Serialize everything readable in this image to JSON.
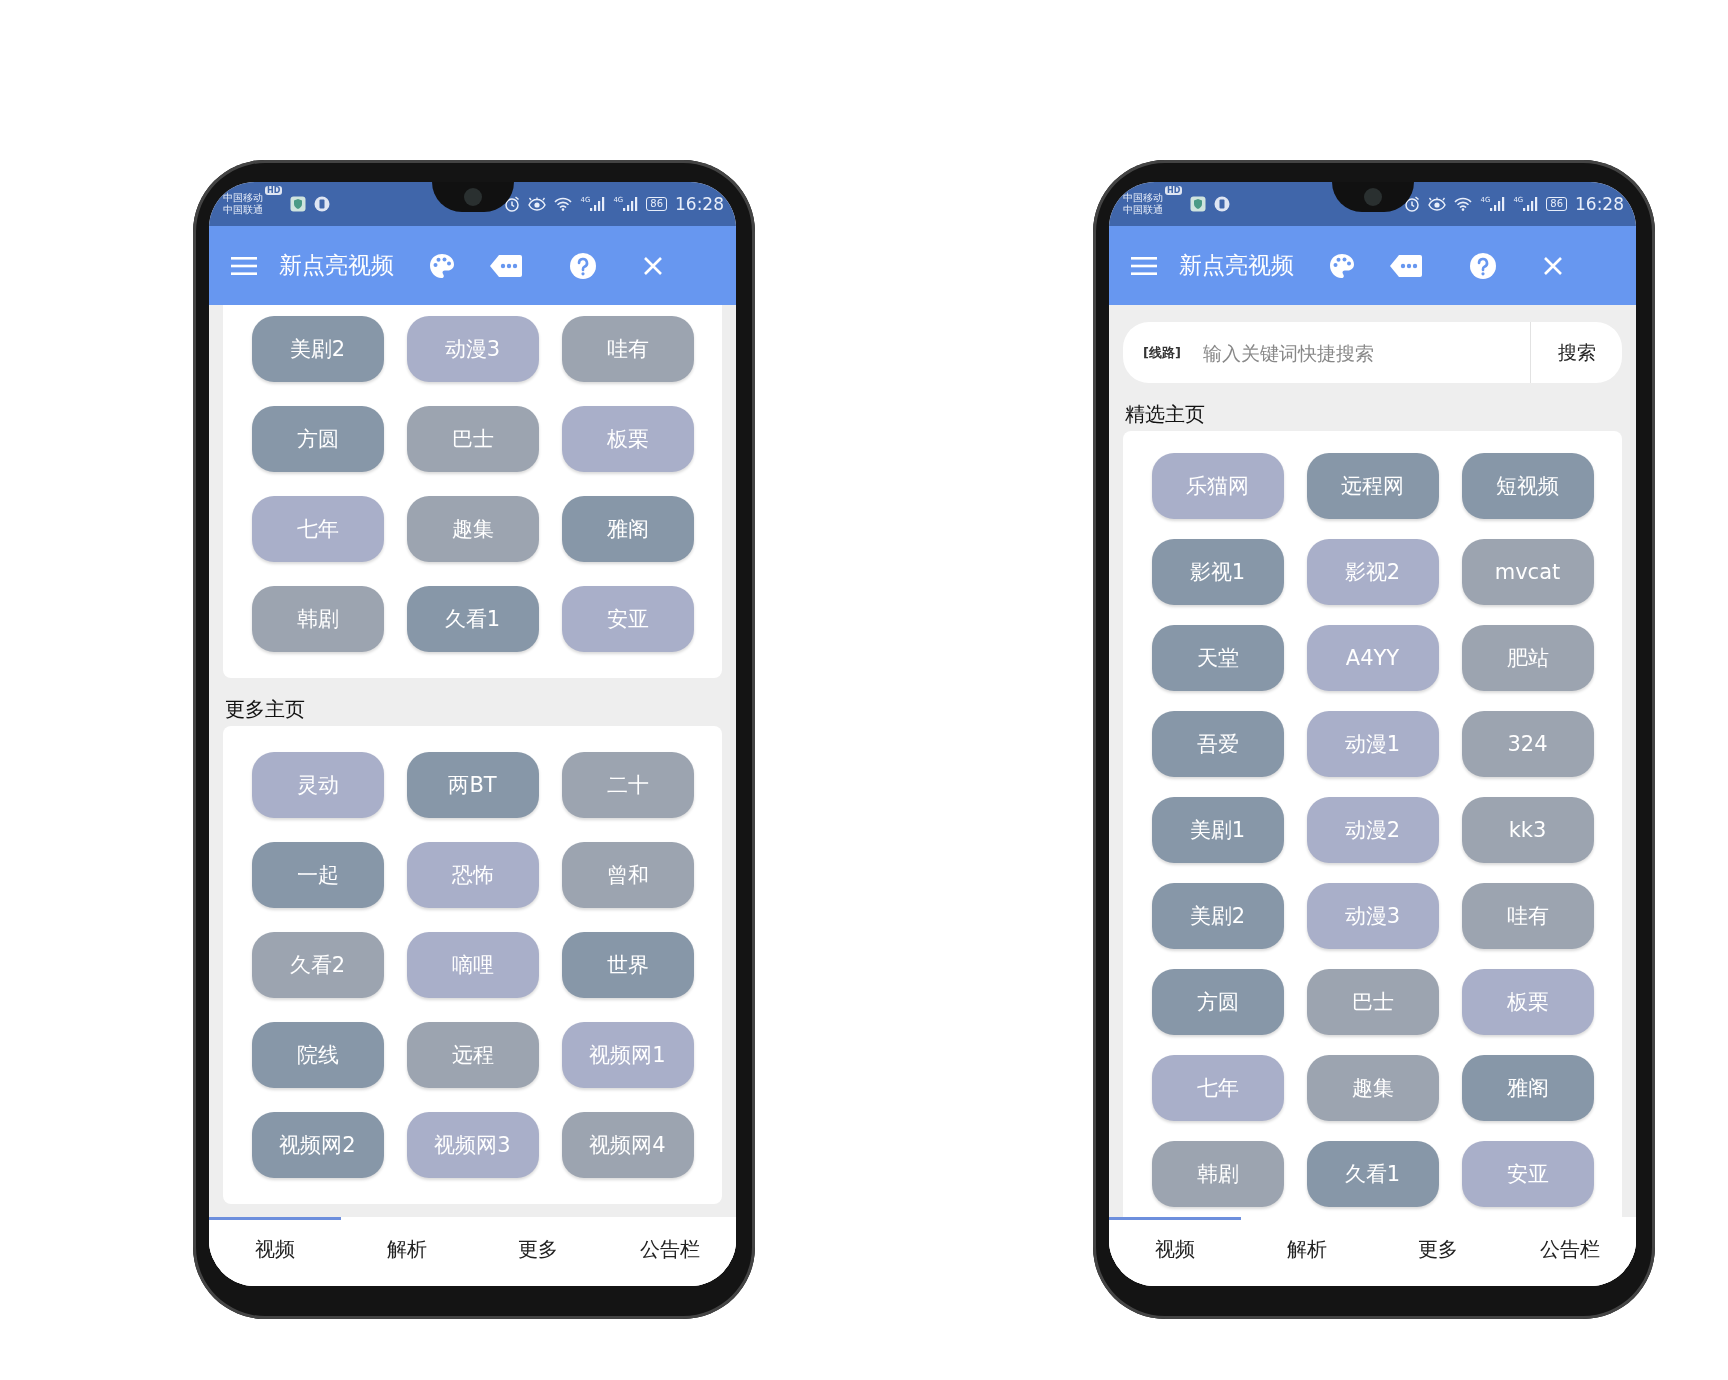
{
  "phones": [
    {
      "status_bar": {
        "carriers": [
          "中国移动",
          "中国联通"
        ],
        "hd_badge": "HD",
        "networks": [
          "4G",
          "4G"
        ],
        "battery": "86",
        "time": "16:28"
      },
      "app_bar": {
        "title": "新点亮视频"
      },
      "sections": [
        {
          "tags": [
            {
              "label": "美剧2",
              "color": "#8797a8"
            },
            {
              "label": "动漫3",
              "color": "#a9afc9"
            },
            {
              "label": "哇有",
              "color": "#9ca4b0"
            },
            {
              "label": "方圆",
              "color": "#8797a8"
            },
            {
              "label": "巴士",
              "color": "#9ca4b0"
            },
            {
              "label": "板栗",
              "color": "#a9afc9"
            },
            {
              "label": "七年",
              "color": "#a9afc9"
            },
            {
              "label": "趣集",
              "color": "#9ca4b0"
            },
            {
              "label": "雅阁",
              "color": "#8797a8"
            },
            {
              "label": "韩剧",
              "color": "#9ca4b0"
            },
            {
              "label": "久看1",
              "color": "#8797a8"
            },
            {
              "label": "安亚",
              "color": "#a9afc9"
            }
          ]
        },
        {
          "heading": "更多主页",
          "tags": [
            {
              "label": "灵动",
              "color": "#a9afc9"
            },
            {
              "label": "两BT",
              "color": "#8797a8"
            },
            {
              "label": "二十",
              "color": "#9ca4b0"
            },
            {
              "label": "一起",
              "color": "#8797a8"
            },
            {
              "label": "恐怖",
              "color": "#a9afc9"
            },
            {
              "label": "曾和",
              "color": "#9ca4b0"
            },
            {
              "label": "久看2",
              "color": "#9ca4b0"
            },
            {
              "label": "嘀哩",
              "color": "#a9afc9"
            },
            {
              "label": "世界",
              "color": "#8797a8"
            },
            {
              "label": "院线",
              "color": "#8797a8"
            },
            {
              "label": "远程",
              "color": "#9ca4b0"
            },
            {
              "label": "视频网1",
              "color": "#a9afc9"
            },
            {
              "label": "视频网2",
              "color": "#8797a8"
            },
            {
              "label": "视频网3",
              "color": "#a9afc9"
            },
            {
              "label": "视频网4",
              "color": "#9ca4b0"
            }
          ]
        }
      ],
      "bottom_nav": [
        {
          "label": "视频",
          "selected": true
        },
        {
          "label": "解析",
          "selected": false
        },
        {
          "label": "更多",
          "selected": false
        },
        {
          "label": "公告栏",
          "selected": false
        }
      ]
    },
    {
      "status_bar": {
        "carriers": [
          "中国移动",
          "中国联通"
        ],
        "hd_badge": "HD",
        "networks": [
          "4G",
          "4G"
        ],
        "battery": "86",
        "time": "16:28"
      },
      "app_bar": {
        "title": "新点亮视频"
      },
      "search": {
        "route_label": "[线路]",
        "placeholder": "输入关键词快捷搜索",
        "button": "搜索"
      },
      "sections": [
        {
          "heading": "精选主页",
          "tags": [
            {
              "label": "乐猫网",
              "color": "#a9afc9"
            },
            {
              "label": "远程网",
              "color": "#8797a8"
            },
            {
              "label": "短视频",
              "color": "#8797a8"
            },
            {
              "label": "影视1",
              "color": "#8797a8"
            },
            {
              "label": "影视2",
              "color": "#a9afc9"
            },
            {
              "label": "mvcat",
              "color": "#9ca4b0"
            },
            {
              "label": "天堂",
              "color": "#8797a8"
            },
            {
              "label": "A4YY",
              "color": "#a9afc9"
            },
            {
              "label": "肥站",
              "color": "#9ca4b0"
            },
            {
              "label": "吾爱",
              "color": "#8797a8"
            },
            {
              "label": "动漫1",
              "color": "#a9afc9"
            },
            {
              "label": "324",
              "color": "#9ca4b0"
            },
            {
              "label": "美剧1",
              "color": "#8797a8"
            },
            {
              "label": "动漫2",
              "color": "#a9afc9"
            },
            {
              "label": "kk3",
              "color": "#9ca4b0"
            },
            {
              "label": "美剧2",
              "color": "#8797a8"
            },
            {
              "label": "动漫3",
              "color": "#a9afc9"
            },
            {
              "label": "哇有",
              "color": "#9ca4b0"
            },
            {
              "label": "方圆",
              "color": "#8797a8"
            },
            {
              "label": "巴士",
              "color": "#9ca4b0"
            },
            {
              "label": "板栗",
              "color": "#a9afc9"
            },
            {
              "label": "七年",
              "color": "#a9afc9"
            },
            {
              "label": "趣集",
              "color": "#9ca4b0"
            },
            {
              "label": "雅阁",
              "color": "#8797a8"
            },
            {
              "label": "韩剧",
              "color": "#9ca4b0"
            },
            {
              "label": "久看1",
              "color": "#8797a8"
            },
            {
              "label": "安亚",
              "color": "#a9afc9"
            }
          ]
        }
      ],
      "bottom_nav": [
        {
          "label": "视频",
          "selected": true
        },
        {
          "label": "解析",
          "selected": false
        },
        {
          "label": "更多",
          "selected": false
        },
        {
          "label": "公告栏",
          "selected": false
        }
      ]
    }
  ]
}
